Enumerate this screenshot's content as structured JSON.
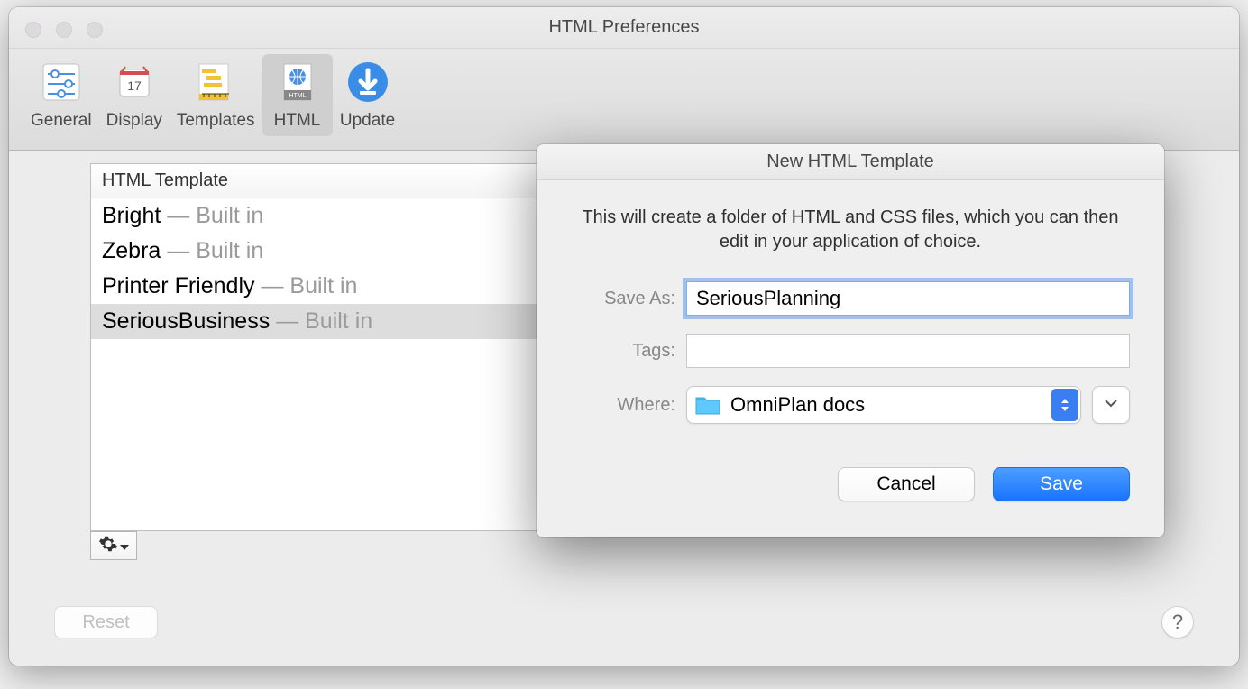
{
  "window": {
    "title": "HTML Preferences"
  },
  "toolbar": {
    "items": [
      {
        "label": "General"
      },
      {
        "label": "Display"
      },
      {
        "label": "Templates"
      },
      {
        "label": "HTML"
      },
      {
        "label": "Update"
      }
    ],
    "selected": 3
  },
  "templates": {
    "header": "HTML Template",
    "rows": [
      {
        "name": "Bright",
        "suffix": " — Built in"
      },
      {
        "name": "Zebra",
        "suffix": " — Built in"
      },
      {
        "name": "Printer Friendly",
        "suffix": " — Built in"
      },
      {
        "name": "SeriousBusiness",
        "suffix": " — Built in"
      }
    ],
    "selected": 3
  },
  "buttons": {
    "reset": "Reset",
    "help": "?"
  },
  "sheet": {
    "title": "New HTML Template",
    "description": "This will create a folder of HTML and CSS files, which you can then edit in your application of choice.",
    "save_as_label": "Save As:",
    "save_as_value": "SeriousPlanning",
    "tags_label": "Tags:",
    "tags_value": "",
    "where_label": "Where:",
    "where_value": "OmniPlan docs",
    "cancel": "Cancel",
    "save": "Save"
  },
  "colors": {
    "accent": "#2b7fff",
    "folder": "#5ec8ff"
  }
}
